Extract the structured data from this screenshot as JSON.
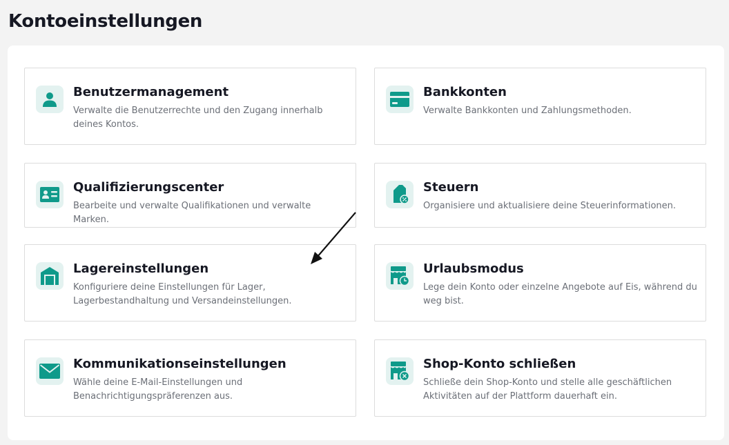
{
  "page": {
    "title": "Kontoeinstellungen"
  },
  "colors": {
    "accent": "#0f9a8a",
    "icon_bg": "#e3f2f0",
    "title": "#161823",
    "description": "#6b6f77",
    "border": "#dcdcdc"
  },
  "cards": [
    {
      "icon": "user-icon",
      "title": "Benutzermanagement",
      "description": "Verwalte die Benutzerrechte und den Zugang innerhalb deines Kontos."
    },
    {
      "icon": "bank-card-icon",
      "title": "Bankkonten",
      "description": "Verwalte Bankkonten und Zahlungsmethoden."
    },
    {
      "icon": "id-card-icon",
      "title": "Qualifizierungscenter",
      "description": "Bearbeite und verwalte Qualifikationen und verwalte Marken."
    },
    {
      "icon": "tax-document-icon",
      "title": "Steuern",
      "description": "Organisiere und aktualisiere deine Steuerinformationen."
    },
    {
      "icon": "warehouse-icon",
      "title": "Lagereinstellungen",
      "description": "Konfiguriere deine Einstellungen für Lager, Lagerbestandhaltung und Versandeinstellungen."
    },
    {
      "icon": "store-clock-icon",
      "title": "Urlaubsmodus",
      "description": "Lege dein Konto oder einzelne Angebote auf Eis, während du weg bist."
    },
    {
      "icon": "envelope-icon",
      "title": "Kommunikationseinstellungen",
      "description": "Wähle deine E-Mail-Einstellungen und Benachrichtigungspräferenzen aus."
    },
    {
      "icon": "store-close-icon",
      "title": "Shop-Konto schließen",
      "description": "Schließe dein Shop-Konto und stelle alle geschäftlichen Aktivitäten auf der Plattform dauerhaft ein."
    }
  ],
  "annotation": {
    "icon": "arrow-pointer-icon"
  }
}
